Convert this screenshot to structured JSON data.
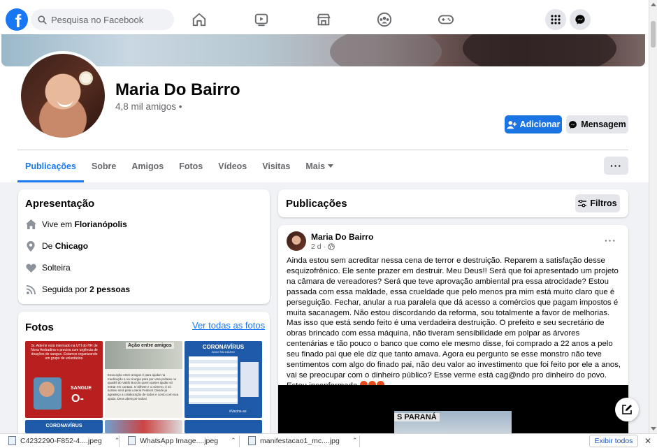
{
  "topnav": {
    "logo": "f",
    "search_placeholder": "Pesquisa no Facebook"
  },
  "profile": {
    "name": "Maria Do Bairro",
    "friends": "4,8 mil amigos •",
    "add_button": "Adicionar",
    "message_button": "Mensagem"
  },
  "tabs": [
    "Publicações",
    "Sobre",
    "Amigos",
    "Fotos",
    "Vídeos",
    "Visitas",
    "Mais"
  ],
  "intro": {
    "title": "Apresentação",
    "lives_prefix": "Vive em ",
    "lives_city": "Florianópolis",
    "from_prefix": "De ",
    "from_city": "Chicago",
    "relationship": "Solteira",
    "followed_prefix": "Seguida por ",
    "followed_count": "2 pessoas"
  },
  "photos": {
    "title": "Fotos",
    "see_all": "Ver todas as fotos",
    "p1_text": "Sr. Ademir está internado na UTI do HR de Nova Andradina e precisa com urgência de doações de sangue. Estamos organizando um grupo de voluntários.",
    "p1_label": "SANGUE",
    "p1_type": "O-",
    "p2_title": "Ação entre amigos",
    "p2_text": "Essa ação entre amigos é para ajudar na medicação e na cirurgia para por uma prótese no quadril do Valdir Buzolo quem quiser ajudar só entrar em contato. O bilhete e o número, é só sorteio será pela Loteria Federal. Desde já agradeço a colaboração de todos e conto com sua ajuda. Deus abençoe todos!",
    "p3_title": "CORONAVÍRUS",
    "p3_sub": "BOLETIM DIÁRIO",
    "p3_tag": "#Vacine-se",
    "p4_title": "CORONAVÍRUS"
  },
  "posts": {
    "title": "Publicações",
    "filters": "Filtros",
    "author": "Maria Do Bairro",
    "time": "2 d ·",
    "body": "Ainda estou sem acreditar nessa cena de terror e destruição. Reparem a satisfação desse esquizofrênico. Ele sente prazer em destruir. Meu Deus!! Será que foi apresentado um projeto na câmara de vereadores? Será que teve aprovação ambiental pra essa atrocidade? Estou passada com essa maldade, essa crueldade que pelo menos pra mim está muito claro que é perseguição. Fechar, anular a rua paralela que dá acesso a comércios que pagam impostos é muita sacanagem. Não estou discordando da reforma, sou totalmente a favor de melhorias. Mas isso que está sendo feito é uma verdadeira destruição. O prefeito e seu secretário de obras brincado com essa máquina, não tiveram sensibilidade em polpar as árvores centenárias e tão pouco o banco que como ele mesmo disse,  foi comprado a 22 anos a pelo seu finado pai que ele diz que tanto amava. Agora eu pergunto se esse monstro não teve sentimentos com algo do finado pai, não deu valor ao investimento que foi feito por ele a anos, vai se preocupar com o dinheiro público? Esse verme está cag@ndo pro dinheiro do povo. Estou inconformada.",
    "image_sign": "S PARANÁ"
  },
  "downloads": {
    "items": [
      "C4232290-F852-4....jpeg",
      "WhatsApp Image....jpeg",
      "manifestacao1_mc....jpg"
    ],
    "show_all": "Exibir todos"
  },
  "colors": {
    "facebook_blue": "#1877f2",
    "background": "#f0f2f5"
  }
}
